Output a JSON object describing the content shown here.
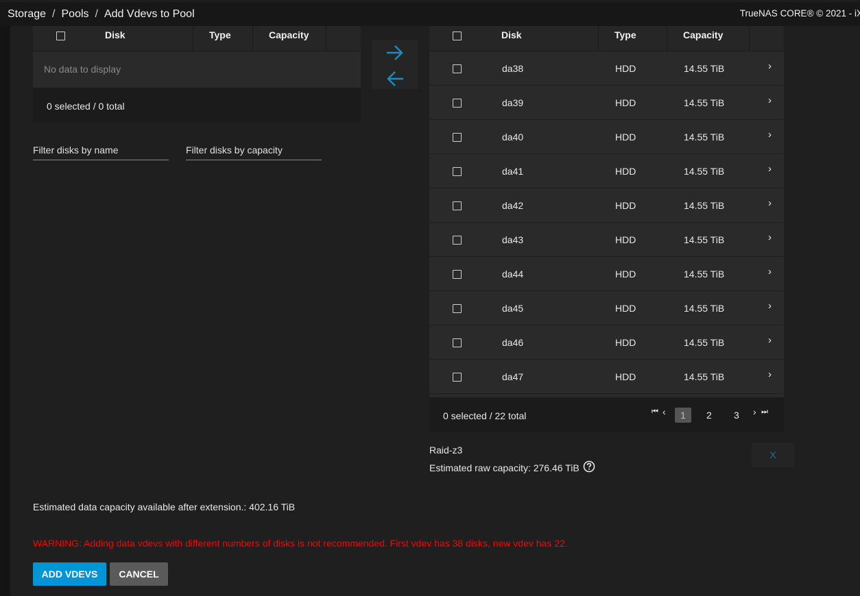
{
  "breadcrumb": {
    "items": [
      "Storage",
      "Pools",
      "Add Vdevs to Pool"
    ]
  },
  "brand": "TrueNAS CORE® © 2021 - iX",
  "left_table": {
    "columns": [
      "Disk",
      "Type",
      "Capacity"
    ],
    "empty_message": "No data to display",
    "footer": "0 selected / 0 total"
  },
  "filters": {
    "name_placeholder": "Filter disks by name",
    "capacity_placeholder": "Filter disks by capacity"
  },
  "right_table": {
    "columns": [
      "Disk",
      "Type",
      "Capacity"
    ],
    "rows": [
      {
        "disk": "da38",
        "type": "HDD",
        "capacity": "14.55 TiB"
      },
      {
        "disk": "da39",
        "type": "HDD",
        "capacity": "14.55 TiB"
      },
      {
        "disk": "da40",
        "type": "HDD",
        "capacity": "14.55 TiB"
      },
      {
        "disk": "da41",
        "type": "HDD",
        "capacity": "14.55 TiB"
      },
      {
        "disk": "da42",
        "type": "HDD",
        "capacity": "14.55 TiB"
      },
      {
        "disk": "da43",
        "type": "HDD",
        "capacity": "14.55 TiB"
      },
      {
        "disk": "da44",
        "type": "HDD",
        "capacity": "14.55 TiB"
      },
      {
        "disk": "da45",
        "type": "HDD",
        "capacity": "14.55 TiB"
      },
      {
        "disk": "da46",
        "type": "HDD",
        "capacity": "14.55 TiB"
      },
      {
        "disk": "da47",
        "type": "HDD",
        "capacity": "14.55 TiB"
      }
    ],
    "footer": "0 selected / 22 total",
    "pages": [
      "1",
      "2",
      "3"
    ],
    "current_page": "1"
  },
  "vdev": {
    "layout": "Raid-z3",
    "estimated_raw_capacity": "Estimated raw capacity: 276.46 TiB",
    "remove_label": "X"
  },
  "summary": {
    "estimated_data_capacity": "Estimated data capacity available after extension.: 402.16 TiB",
    "warning": "WARNING: Adding data vdevs with different numbers of disks is not recommended. First vdev has 38 disks, new vdev has 22."
  },
  "actions": {
    "add_label": "ADD VDEVS",
    "cancel_label": "CANCEL"
  },
  "colors": {
    "accent": "#0095d5",
    "warning": "#ff0000",
    "arrow": "#1e8bc3"
  }
}
